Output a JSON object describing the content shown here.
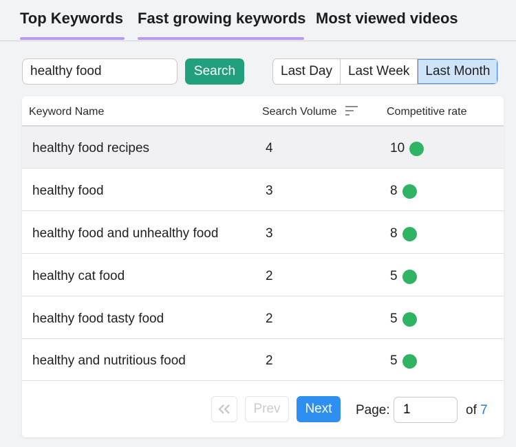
{
  "tabs": [
    {
      "label": "Top Keywords",
      "underlined": true
    },
    {
      "label": "Fast growing keywords",
      "underlined": true
    },
    {
      "label": "Most viewed videos",
      "underlined": false
    }
  ],
  "search": {
    "value": "healthy food",
    "button_label": "Search"
  },
  "time_range": {
    "options": [
      "Last Day",
      "Last Week",
      "Last Month"
    ],
    "selected": "Last Month"
  },
  "table": {
    "columns": [
      "Keyword Name",
      "Search Volume",
      "Competitive rate"
    ],
    "sort_icon": "sort-lines-icon",
    "rows": [
      {
        "keyword": "healthy food recipes",
        "volume": "4",
        "rate": "10"
      },
      {
        "keyword": "healthy food",
        "volume": "3",
        "rate": "8"
      },
      {
        "keyword": "healthy food and unhealthy food",
        "volume": "3",
        "rate": "8"
      },
      {
        "keyword": "healthy cat food",
        "volume": "2",
        "rate": "5"
      },
      {
        "keyword": "healthy food tasty food",
        "volume": "2",
        "rate": "5"
      },
      {
        "keyword": "healthy and nutritious food",
        "volume": "2",
        "rate": "5"
      }
    ]
  },
  "pagination": {
    "first_icon": "double-chevron-left-icon",
    "prev_label": "Prev",
    "next_label": "Next",
    "page_label": "Page:",
    "current_page": "1",
    "of_label": "of",
    "total_pages": "7"
  },
  "colors": {
    "tab_underline": "#b99af0",
    "search_button": "#22a07e",
    "next_button": "#2f8ff0",
    "active_range": "#cfe4f9",
    "status_dot": "#2fb463",
    "total_pages_text": "#2a7ec8"
  }
}
